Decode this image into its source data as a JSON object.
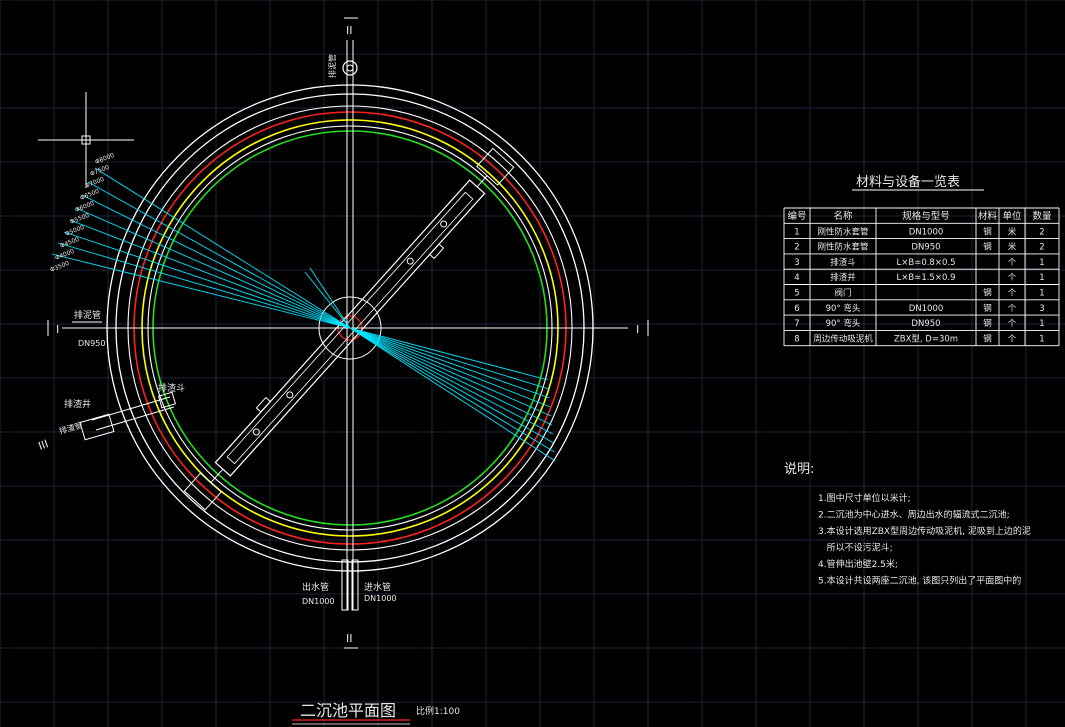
{
  "drawing": {
    "title": "二沉池平面图",
    "scale": "比例1:100",
    "section_marks": {
      "left": "I",
      "right": "I",
      "top": "II",
      "bottom": "II",
      "lower_left": "III"
    },
    "labels": {
      "overflow_pipe": "排泥管",
      "overflow_dn": "DN950",
      "outlet_pipe": "出水管",
      "outlet_dn": "DN1000",
      "inlet_pipe": "进水管",
      "inlet_dn": "DN1000",
      "scum_hopper": "排渣斗",
      "scum_well": "排渣井",
      "scum_pipe": "排渣管",
      "top_pipe": "排泥管"
    },
    "leader_labels": [
      "Φ8000",
      "Φ7500",
      "Φ7000",
      "Φ6500",
      "Φ6000",
      "Φ5500",
      "Φ5000",
      "Φ4500",
      "Φ4000",
      "Φ3500"
    ],
    "colors": {
      "background": "#000000",
      "grid": "#1e2536",
      "line": "#ffffff",
      "red": "#ff2020",
      "yellow": "#ffff00",
      "green": "#22dd22",
      "cyan": "#00e5ff"
    }
  },
  "table": {
    "title": "材料与设备一览表",
    "headers": [
      "编号",
      "名称",
      "规格与型号",
      "材料",
      "单位",
      "数量"
    ],
    "rows": [
      [
        "1",
        "刚性防水套管",
        "DN1000",
        "钢",
        "米",
        "2"
      ],
      [
        "2",
        "刚性防水套管",
        "DN950",
        "钢",
        "米",
        "2"
      ],
      [
        "3",
        "排渣斗",
        "L×B=0.8×0.5",
        "",
        "个",
        "1"
      ],
      [
        "4",
        "排渣井",
        "L×B=1.5×0.9",
        "",
        "个",
        "1"
      ],
      [
        "5",
        "阀门",
        "",
        "钢",
        "个",
        "1"
      ],
      [
        "6",
        "90° 弯头",
        "DN1000",
        "钢",
        "个",
        "3"
      ],
      [
        "7",
        "90° 弯头",
        "DN950",
        "钢",
        "个",
        "1"
      ],
      [
        "8",
        "周边传动吸泥机",
        "ZBX型, D=30m",
        "钢",
        "个",
        "1"
      ]
    ]
  },
  "notes": {
    "heading": "说明:",
    "items": [
      "1.图中尺寸单位以米计;",
      "2.二沉池为中心进水、周边出水的辐流式二沉池;",
      "3.本设计选用ZBX型周边传动吸泥机, 泥吸到上边的泥",
      "   所以不设污泥斗;",
      "4.管伸出池壁2.5米;",
      "5.本设计共设两座二沉池, 该图只列出了平面图中的"
    ]
  }
}
